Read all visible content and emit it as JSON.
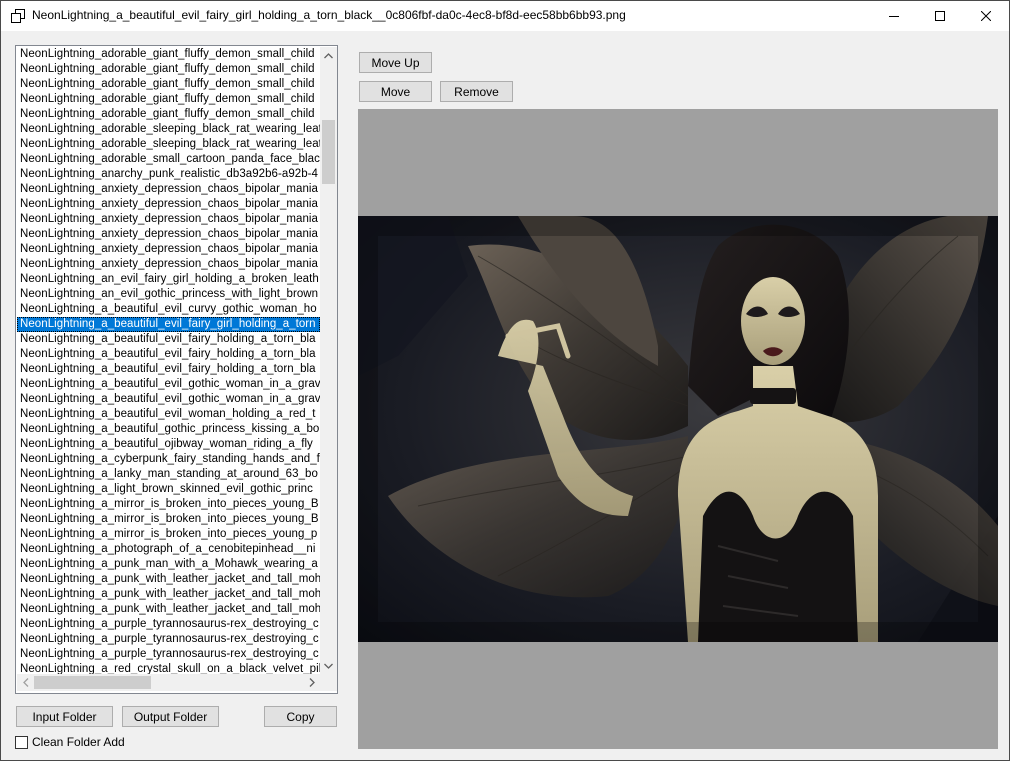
{
  "window": {
    "title": "NeonLightning_a_beautiful_evil_fairy_girl_holding_a_torn_black__0c806fbf-da0c-4ec8-bf8d-eec58bb6bb93.png"
  },
  "file_list": {
    "selected_index": 18,
    "items": [
      "NeonLightning_adorable_giant_fluffy_demon_small_child",
      "NeonLightning_adorable_giant_fluffy_demon_small_child",
      "NeonLightning_adorable_giant_fluffy_demon_small_child",
      "NeonLightning_adorable_giant_fluffy_demon_small_child",
      "NeonLightning_adorable_giant_fluffy_demon_small_child",
      "NeonLightning_adorable_sleeping_black_rat_wearing_leat",
      "NeonLightning_adorable_sleeping_black_rat_wearing_leat",
      "NeonLightning_adorable_small_cartoon_panda_face_black",
      "NeonLightning_anarchy_punk_realistic_db3a92b6-a92b-4",
      "NeonLightning_anxiety_depression_chaos_bipolar_mania",
      "NeonLightning_anxiety_depression_chaos_bipolar_mania",
      "NeonLightning_anxiety_depression_chaos_bipolar_mania",
      "NeonLightning_anxiety_depression_chaos_bipolar_mania",
      "NeonLightning_anxiety_depression_chaos_bipolar_mania",
      "NeonLightning_anxiety_depression_chaos_bipolar_mania",
      "NeonLightning_an_evil_fairy_girl_holding_a_broken_leath",
      "NeonLightning_an_evil_gothic_princess_with_light_brown",
      "NeonLightning_a_beautiful_evil_curvy_gothic_woman_ho",
      "NeonLightning_a_beautiful_evil_fairy_girl_holding_a_torn",
      "NeonLightning_a_beautiful_evil_fairy_holding_a_torn_bla",
      "NeonLightning_a_beautiful_evil_fairy_holding_a_torn_bla",
      "NeonLightning_a_beautiful_evil_fairy_holding_a_torn_bla",
      "NeonLightning_a_beautiful_evil_gothic_woman_in_a_grav",
      "NeonLightning_a_beautiful_evil_gothic_woman_in_a_grav",
      "NeonLightning_a_beautiful_evil_woman_holding_a_red_t",
      "NeonLightning_a_beautiful_gothic_princess_kissing_a_bo",
      "NeonLightning_a_beautiful_ojibway_woman_riding_a_fly",
      "NeonLightning_a_cyberpunk_fairy_standing_hands_and_f",
      "NeonLightning_a_lanky_man_standing_at_around_63_bo",
      "NeonLightning_a_light_brown_skinned_evil_gothic_princ",
      "NeonLightning_a_mirror_is_broken_into_pieces_young_B",
      "NeonLightning_a_mirror_is_broken_into_pieces_young_B",
      "NeonLightning_a_mirror_is_broken_into_pieces_young_p",
      "NeonLightning_a_photograph_of_a_cenobitepinhead__ni",
      "NeonLightning_a_punk_man_with_a_Mohawk_wearing_a",
      "NeonLightning_a_punk_with_leather_jacket_and_tall_moh",
      "NeonLightning_a_punk_with_leather_jacket_and_tall_moh",
      "NeonLightning_a_punk_with_leather_jacket_and_tall_moh",
      "NeonLightning_a_purple_tyrannosaurus-rex_destroying_c",
      "NeonLightning_a_purple_tyrannosaurus-rex_destroying_c",
      "NeonLightning_a_purple_tyrannosaurus-rex_destroying_c",
      "NeonLightning_a_red_crystal_skull_on_a_black_velvet_pill"
    ]
  },
  "buttons": {
    "move_up": "Move Up",
    "move": "Move",
    "remove": "Remove",
    "input_folder": "Input Folder",
    "output_folder": "Output Folder",
    "copy": "Copy"
  },
  "options": {
    "clean_folder_add_label": "Clean Folder Add",
    "clean_folder_add_checked": false
  },
  "colors": {
    "selection": "#0078d7",
    "preview_background": "#a0a0a0"
  },
  "icons": {
    "app": "window-restore-icon",
    "minimize": "minimize-icon",
    "maximize": "maximize-icon",
    "close": "close-icon"
  }
}
